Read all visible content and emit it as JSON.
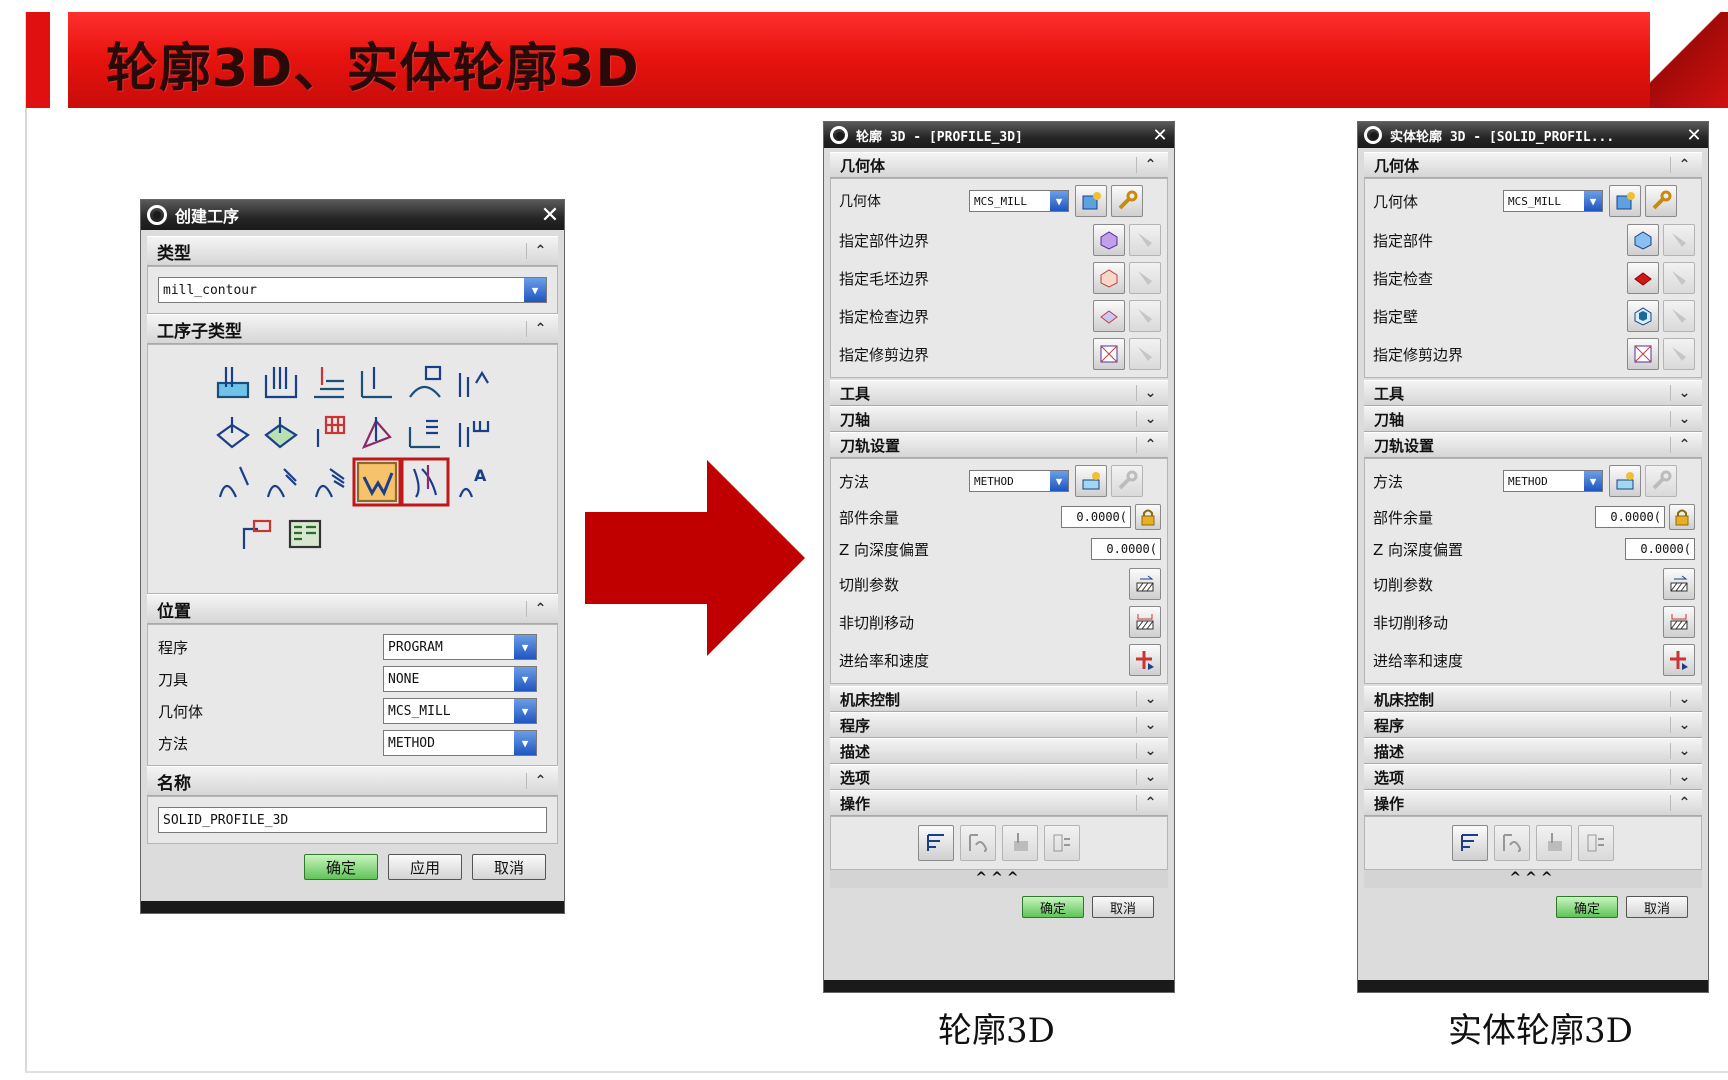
{
  "slide": {
    "title": "轮廓3D、实体轮廓3D",
    "colors": {
      "band": "#e8140f",
      "arrow": "#c00000",
      "ok_green": "#5fc457",
      "dialog_title": "#262626"
    }
  },
  "create_op": {
    "title": "创建工序",
    "sec_type": "类型",
    "type_value": "mill_contour",
    "sec_subtype": "工序子类型",
    "sec_location": "位置",
    "rows": [
      {
        "label": "程序",
        "value": "PROGRAM"
      },
      {
        "label": "刀具",
        "value": "NONE"
      },
      {
        "label": "几何体",
        "value": "MCS_MILL"
      },
      {
        "label": "方法",
        "value": "METHOD"
      }
    ],
    "sec_name": "名称",
    "name_value": "SOLID_PROFILE_3D",
    "btn_ok": "确定",
    "btn_apply": "应用",
    "btn_cancel": "取消"
  },
  "profile3d": {
    "title": "轮廓 3D - [PROFILE_3D]",
    "sec_geometry": "几何体",
    "geom_label": "几何体",
    "geom_value": "MCS_MILL",
    "geom_rows": [
      "指定部件边界",
      "指定毛坯边界",
      "指定检查边界",
      "指定修剪边界"
    ],
    "sec_tool": "工具",
    "sec_axis": "刀轴",
    "sec_path": "刀轨设置",
    "method_label": "方法",
    "method_value": "METHOD",
    "stock_label": "部件余量",
    "stock_value": "0.0000(",
    "zoffset_label": "Z 向深度偏置",
    "zoffset_value": "0.0000(",
    "cut_label": "切削参数",
    "noncut_label": "非切削移动",
    "feed_label": "进给率和速度",
    "sec_machine": "机床控制",
    "sec_program": "程序",
    "sec_desc": "描述",
    "sec_options": "选项",
    "sec_actions": "操作",
    "more": "^^^",
    "btn_ok": "确定",
    "btn_cancel": "取消"
  },
  "solidprofile3d": {
    "title": "实体轮廓 3D - [SOLID_PROFIL...",
    "sec_geometry": "几何体",
    "geom_label": "几何体",
    "geom_value": "MCS_MILL",
    "geom_rows": [
      "指定部件",
      "指定检查",
      "指定壁",
      "指定修剪边界"
    ],
    "sec_tool": "工具",
    "sec_axis": "刀轴",
    "sec_path": "刀轨设置",
    "method_label": "方法",
    "method_value": "METHOD",
    "stock_label": "部件余量",
    "stock_value": "0.0000(",
    "zoffset_label": "Z 向深度偏置",
    "zoffset_value": "0.0000(",
    "cut_label": "切削参数",
    "noncut_label": "非切削移动",
    "feed_label": "进给率和速度",
    "sec_machine": "机床控制",
    "sec_program": "程序",
    "sec_desc": "描述",
    "sec_options": "选项",
    "sec_actions": "操作",
    "more": "^^^",
    "btn_ok": "确定",
    "btn_cancel": "取消"
  },
  "captions": {
    "left": "轮廓3D",
    "right": "实体轮廓3D"
  }
}
